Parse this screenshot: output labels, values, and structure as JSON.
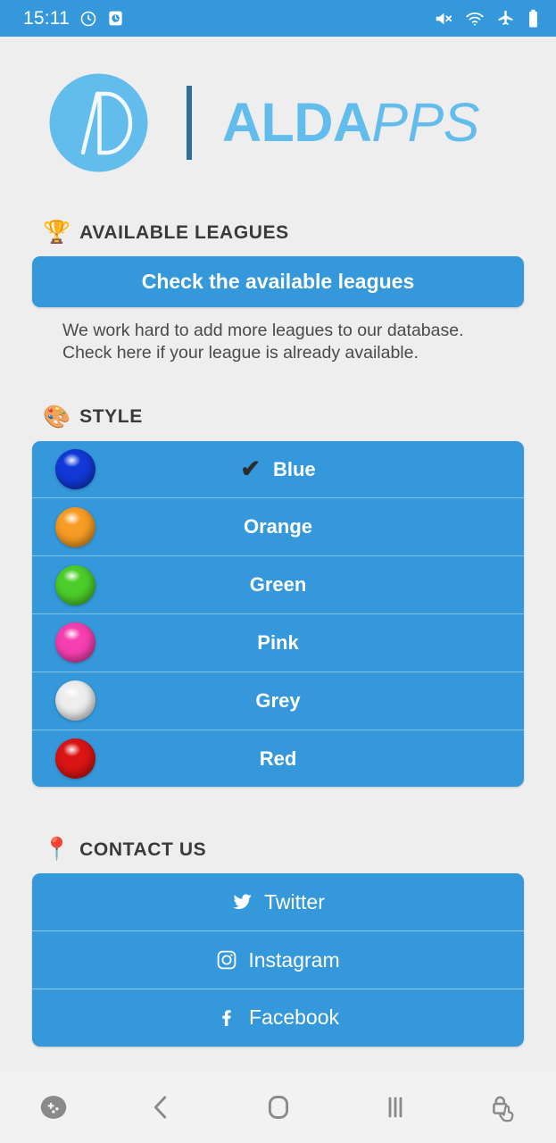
{
  "status_bar": {
    "time": "15:11",
    "left_icons": [
      "alarm-icon",
      "clock-widget-icon"
    ],
    "right_icons": [
      "mute-icon",
      "wifi-icon",
      "airplane-mode-icon",
      "battery-icon"
    ],
    "background_color": "#3498db"
  },
  "header": {
    "logo_mark_name": "aldapps-monogram",
    "brand_bold": "ALDA",
    "brand_italic": "PPS",
    "brand_color": "#63bdec",
    "divider_color": "#2f6f9f"
  },
  "sections": {
    "leagues": {
      "emoji": "🏆",
      "emoji_name": "trophy-emoji",
      "title": "AVAILABLE LEAGUES",
      "button_label": "Check the available leagues",
      "helper_line_1": "We work hard to add more leagues to our database.",
      "helper_line_2": "Check here if your league is already available."
    },
    "style": {
      "emoji": "🎨",
      "emoji_name": "artist-palette-emoji",
      "title": "STYLE",
      "selected": "Blue",
      "check_glyph": "✔",
      "options": [
        {
          "label": "Blue",
          "color": "#1239d8",
          "selected": true
        },
        {
          "label": "Orange",
          "color": "#f79c24",
          "selected": false
        },
        {
          "label": "Green",
          "color": "#4ccd2a",
          "selected": false
        },
        {
          "label": "Pink",
          "color": "#f63fb0",
          "selected": false
        },
        {
          "label": "Grey",
          "color": "#eeeeee",
          "selected": false
        },
        {
          "label": "Red",
          "color": "#db1414",
          "selected": false
        }
      ]
    },
    "contact": {
      "emoji": "📍",
      "emoji_name": "round-pushpin-emoji",
      "title": "CONTACT US",
      "links": [
        {
          "label": "Twitter",
          "icon": "twitter-icon"
        },
        {
          "label": "Instagram",
          "icon": "instagram-icon"
        },
        {
          "label": "Facebook",
          "icon": "facebook-icon"
        }
      ]
    }
  },
  "nav_bar": {
    "items": [
      {
        "name": "game-launcher-icon"
      },
      {
        "name": "back-icon"
      },
      {
        "name": "home-icon"
      },
      {
        "name": "recents-icon"
      },
      {
        "name": "screen-lock-touch-icon"
      }
    ]
  },
  "theme": {
    "accent": "#3498db",
    "page_background": "#eeeeee",
    "divider": "#7fc0e8"
  }
}
